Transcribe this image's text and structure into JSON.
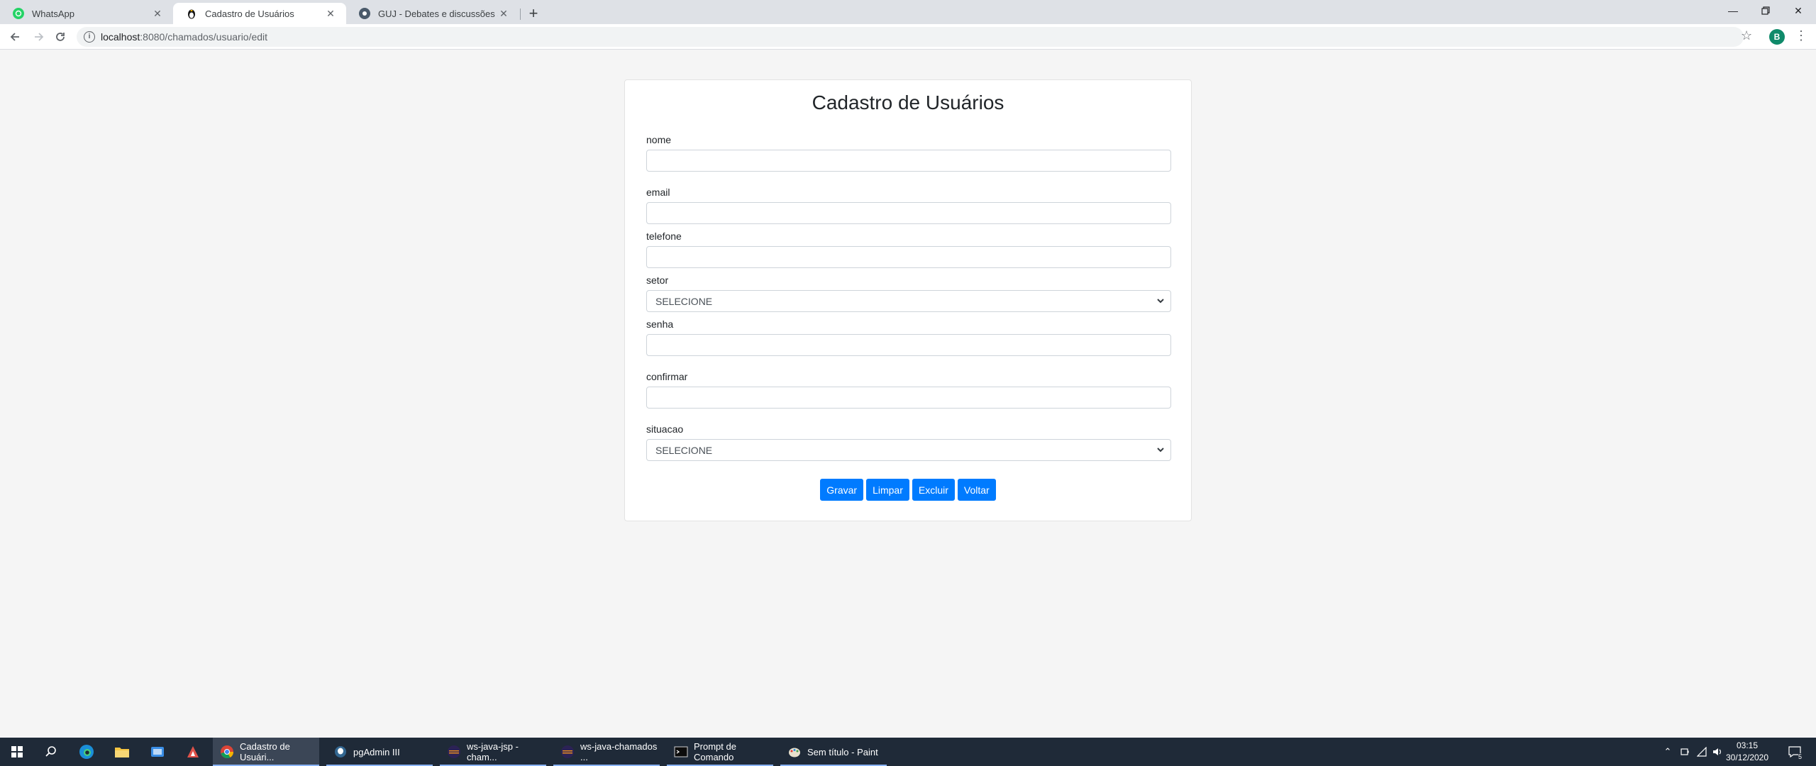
{
  "browser": {
    "tabs": [
      {
        "title": "WhatsApp",
        "icon": "whatsapp-icon"
      },
      {
        "title": "Cadastro de Usuários",
        "icon": "tux-icon"
      },
      {
        "title": "GUJ - Debates e discussões sobre",
        "icon": "guj-icon"
      }
    ],
    "url_host": "localhost",
    "url_path": ":8080/chamados/usuario/edit",
    "avatar_letter": "B"
  },
  "form": {
    "title": "Cadastro de Usuários",
    "labels": {
      "nome": "nome",
      "email": "email",
      "telefone": "telefone",
      "setor": "setor",
      "senha": "senha",
      "confirmar": "confirmar",
      "situacao": "situacao"
    },
    "setor_selected": "SELECIONE",
    "situacao_selected": "SELECIONE",
    "buttons": {
      "gravar": "Gravar",
      "limpar": "Limpar",
      "excluir": "Excluir",
      "voltar": "Voltar"
    }
  },
  "taskbar": {
    "apps": [
      {
        "label": "Cadastro de Usuári..."
      },
      {
        "label": "pgAdmin III"
      },
      {
        "label": "ws-java-jsp - cham..."
      },
      {
        "label": "ws-java-chamados ..."
      },
      {
        "label": "Prompt de Comando"
      },
      {
        "label": "Sem título - Paint"
      }
    ],
    "time": "03:15",
    "date": "30/12/2020",
    "notifications": "5"
  },
  "colors": {
    "primary": "#007bff",
    "page_bg": "#f5f5f5",
    "taskbar": "#1f2a38"
  }
}
